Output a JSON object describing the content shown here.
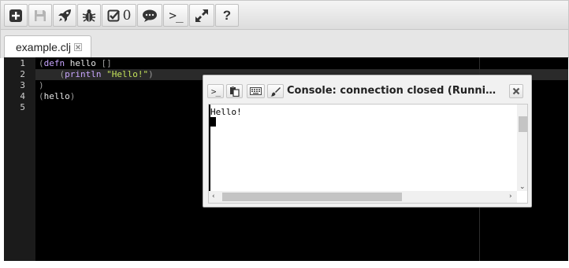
{
  "toolbar": {
    "buttons": [
      {
        "name": "new-file-button",
        "icon": "plus-icon"
      },
      {
        "name": "save-button",
        "icon": "floppy-icon"
      },
      {
        "name": "run-button",
        "icon": "rocket-icon"
      },
      {
        "name": "debug-button",
        "icon": "bug-icon"
      },
      {
        "name": "tests-button",
        "icon": "checkbox-icon",
        "count": "0"
      },
      {
        "name": "comment-button",
        "icon": "speech-bubble-icon"
      },
      {
        "name": "console-button",
        "icon": "terminal-prompt-icon",
        "label": ">_"
      },
      {
        "name": "fullscreen-button",
        "icon": "expand-arrows-icon"
      },
      {
        "name": "help-button",
        "icon": "question-mark-icon",
        "label": "?"
      }
    ]
  },
  "tabs": [
    {
      "label": "example.clj",
      "close_icon": "close-icon"
    }
  ],
  "editor": {
    "active_line": 2,
    "lines": [
      {
        "num": "1",
        "tokens": [
          {
            "t": "(",
            "k": "paren"
          },
          {
            "t": "defn",
            "k": "kw"
          },
          {
            "t": " hello ",
            "k": "plain"
          },
          {
            "t": "[]",
            "k": "paren"
          }
        ]
      },
      {
        "num": "2",
        "tokens": [
          {
            "t": "    ",
            "k": "plain"
          },
          {
            "t": "(",
            "k": "paren"
          },
          {
            "t": "println",
            "k": "kw"
          },
          {
            "t": " ",
            "k": "plain"
          },
          {
            "t": "\"Hello!\"",
            "k": "str"
          },
          {
            "t": ")",
            "k": "paren"
          }
        ]
      },
      {
        "num": "3",
        "tokens": [
          {
            "t": ")",
            "k": "paren"
          }
        ]
      },
      {
        "num": "4",
        "tokens": [
          {
            "t": "(",
            "k": "paren"
          },
          {
            "t": "hello",
            "k": "plain"
          },
          {
            "t": ")",
            "k": "paren"
          }
        ]
      },
      {
        "num": "5",
        "tokens": []
      }
    ]
  },
  "console": {
    "title": "Console: connection closed (Runni…",
    "buttons": [
      {
        "name": "console-prompt-button",
        "icon": "terminal-prompt-icon",
        "label": ">_"
      },
      {
        "name": "console-copy-button",
        "icon": "clipboard-icon"
      },
      {
        "name": "console-keyboard-button",
        "icon": "keyboard-icon"
      },
      {
        "name": "console-clear-button",
        "icon": "brush-icon"
      }
    ],
    "close_icon": "close-icon",
    "output": "Hello!",
    "scroll": {
      "up": "⌃",
      "down": "⌄",
      "left": "‹",
      "right": "›"
    }
  },
  "colors": {
    "editor_bg": "#000000",
    "gutter_bg": "#1b1b1b",
    "active_line_bg": "#2a2a2a",
    "keyword": "#c9a6ff",
    "string": "#c5e35a",
    "paren": "#9a9a9a"
  }
}
